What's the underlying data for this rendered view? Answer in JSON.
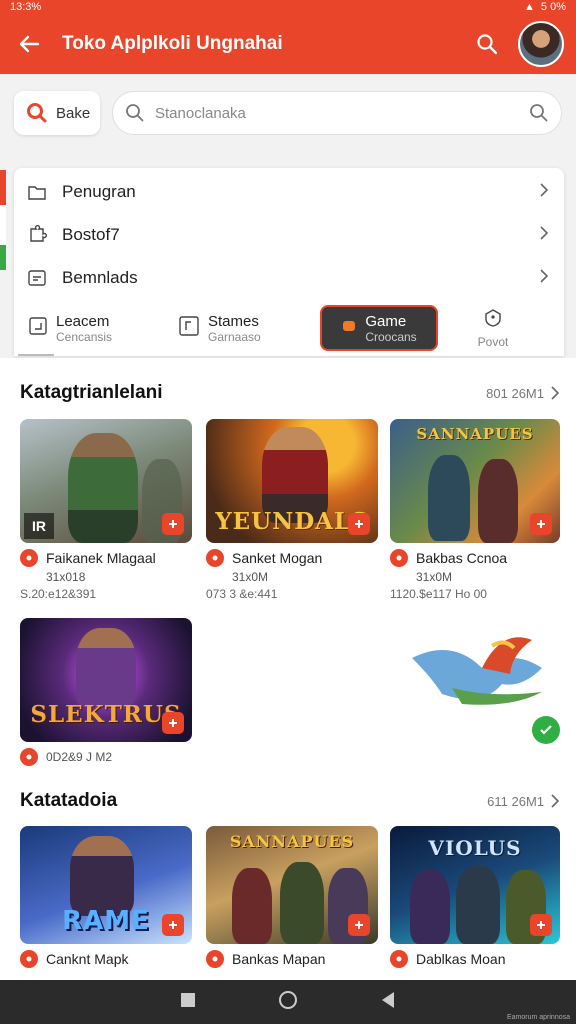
{
  "status": {
    "left": "13:3%",
    "right": "5 0%"
  },
  "app_bar": {
    "title": "Toko Aplplkoli Ungnahai"
  },
  "filter": {
    "label": "Bake"
  },
  "search": {
    "placeholder": "Stanoclanaka"
  },
  "menu": {
    "items": [
      {
        "label": "Penugran",
        "icon": "folder-icon"
      },
      {
        "label": "Bostof7",
        "icon": "puzzle-icon"
      },
      {
        "label": "Bemnlads",
        "icon": "download-box-icon"
      }
    ],
    "tabs": [
      {
        "title": "Leacem",
        "subtitle": "Cencansis",
        "icon": "corner-arrow-icon"
      },
      {
        "title": "Stames",
        "subtitle": "Garnaaso",
        "icon": "bracket-box-icon"
      },
      {
        "title": "Game",
        "subtitle": "Croocans",
        "icon": "controller-icon",
        "active": true
      },
      {
        "title": "",
        "subtitle": "Povot",
        "icon": "shield-icon"
      }
    ]
  },
  "sections": [
    {
      "title": "Katagtrianlelani",
      "more": "801 26M1",
      "cards": [
        {
          "name": "Faikanek Mlagaal",
          "sub1": "31x018",
          "sub2": "S.20:e12&391",
          "corner": "IR"
        },
        {
          "name": "Sanket Mogan",
          "sub1": "31x0M",
          "sub2": "073 3 &e:441",
          "logo": "YEUNDALS"
        },
        {
          "name": "Bakbas Ccnoa",
          "sub1": "31x0M",
          "sub2": "1120.$e117 Ho 00",
          "logo": "SANNAPUES"
        },
        {
          "sub2": "0D2&9 J M2",
          "logo": "SLEKTRUS"
        }
      ]
    },
    {
      "title": "Katatadoia",
      "more": "611 26M1",
      "cards": [
        {
          "name": "Canknt Mapk",
          "logo": "RAME"
        },
        {
          "name": "Bankas Mapan",
          "logo": "SANNAPUES"
        },
        {
          "name": "Dablkas Moan",
          "logo": "VIOLUS"
        }
      ]
    }
  ],
  "nav": {
    "watermark": "Eamorum aprinnosa"
  },
  "colors": {
    "accent": "#e8452a",
    "success": "#2fae44",
    "nav": "#2b2b2b"
  }
}
